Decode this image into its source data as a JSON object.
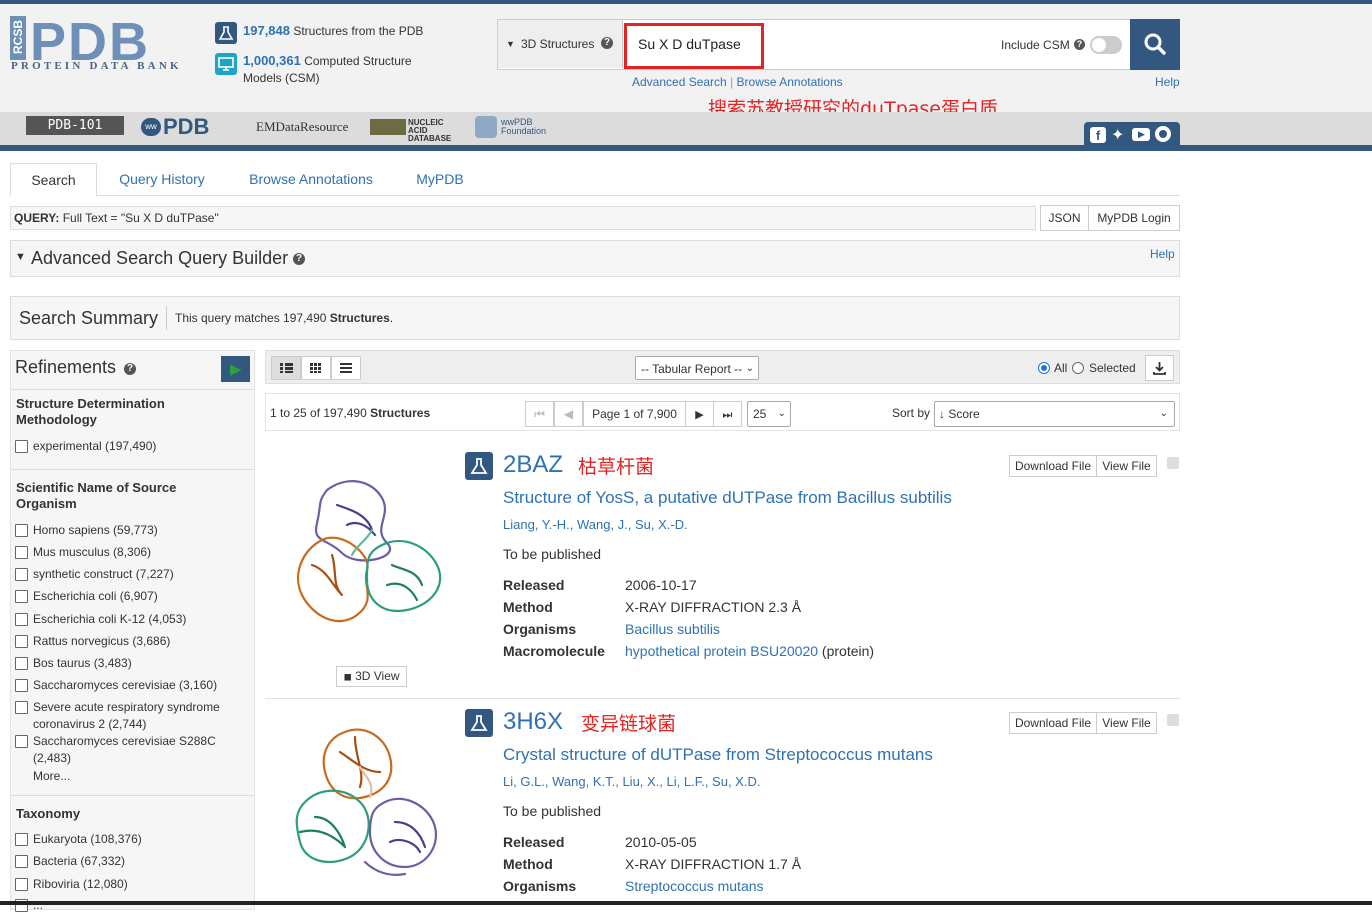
{
  "header": {
    "logo_text": "PDB",
    "logo_prefix": "RCSB",
    "logo_subtitle": "PROTEIN DATA BANK",
    "stats": [
      {
        "count": "197,848",
        "text": "Structures from the PDB"
      },
      {
        "count": "1,000,361",
        "text": "Computed Structure",
        "text2": "Models (CSM)"
      }
    ],
    "search": {
      "scope_label": "3D Structures",
      "query": "Su X D duTpase",
      "include_csm_label": "Include CSM",
      "advanced_search": "Advanced Search",
      "separator": "|",
      "browse_annotations": "Browse Annotations",
      "help": "Help"
    },
    "partners": [
      "PDB-101",
      "wwPDB",
      "EMDataResource",
      "NUCLEIC ACID DATABASE",
      "wwPDB Foundation"
    ]
  },
  "annotation": {
    "note": "搜索苏教授研究的duTpase蛋白质"
  },
  "tabs": [
    "Search",
    "Query History",
    "Browse Annotations",
    "MyPDB"
  ],
  "query": {
    "label": "QUERY:",
    "text": "Full Text = \"Su X D duTPase\"",
    "json_button": "JSON",
    "login_button": "MyPDB Login"
  },
  "builder": {
    "title": "Advanced Search Query Builder",
    "help": "Help"
  },
  "summary": {
    "title": "Search Summary",
    "text_pre": "This query matches 197,490",
    "text_bold": "Structures",
    "text_post": "."
  },
  "refinements": {
    "title": "Refinements",
    "sections": [
      {
        "title": "Structure Determination Methodology",
        "items": [
          "experimental (197,490)"
        ]
      },
      {
        "title": "Scientific Name of Source Organism",
        "items": [
          "Homo sapiens (59,773)",
          "Mus musculus (8,306)",
          "synthetic construct (7,227)",
          "Escherichia coli (6,907)",
          "Escherichia coli K-12 (4,053)",
          "Rattus norvegicus (3,686)",
          "Bos taurus (3,483)",
          "Saccharomyces cerevisiae (3,160)",
          "Severe acute respiratory syndrome",
          "coronavirus 2 (2,744)",
          "Saccharomyces cerevisiae S288C",
          "(2,483)"
        ],
        "more": "More..."
      },
      {
        "title": "Taxonomy",
        "items": [
          "Eukaryota (108,376)",
          "Bacteria (67,332)",
          "Riboviria (12,080)",
          "..."
        ]
      }
    ]
  },
  "toolbar": {
    "report_select": "-- Tabular Report --",
    "radio_all": "All",
    "radio_selected": "Selected"
  },
  "pager": {
    "range_pre": "1 to 25 of 197,490",
    "range_bold": "Structures",
    "page_label": "Page 1 of 7,900",
    "per_page": "25",
    "sort_label": "Sort by",
    "sort_value": "↓ Score"
  },
  "results": [
    {
      "id": "2BAZ",
      "cn_note": "枯草杆菌",
      "title": "Structure of YosS, a putative dUTPase from Bacillus subtilis",
      "authors": "Liang, Y.-H., Wang, J., Su, X.-D.",
      "pub": "To be published",
      "released_label": "Released",
      "released": "2006-10-17",
      "method_label": "Method",
      "method": "X-RAY DIFFRACTION 2.3 Å",
      "organisms_label": "Organisms",
      "organisms": "Bacillus subtilis",
      "macromolecule_label": "Macromolecule",
      "macromolecule": "hypothetical protein BSU20020",
      "macromolecule_suffix": "(protein)",
      "download": "Download File",
      "view": "View File",
      "view3d": "3D View"
    },
    {
      "id": "3H6X",
      "cn_note": "变异链球菌",
      "title": "Crystal structure of dUTPase from Streptococcus mutans",
      "authors": "Li, G.L., Wang, K.T., Liu, X., Li, L.F., Su, X.D.",
      "pub": "To be published",
      "released_label": "Released",
      "released": "2010-05-05",
      "method_label": "Method",
      "method": "X-RAY DIFFRACTION 1.7 Å",
      "organisms_label": "Organisms",
      "organisms": "Streptococcus mutans",
      "download": "Download File",
      "view": "View File"
    }
  ],
  "colors": {
    "brand": "#325880",
    "link": "#2f71b5",
    "annotation": "#e52323",
    "play": "#2e9e3f"
  }
}
